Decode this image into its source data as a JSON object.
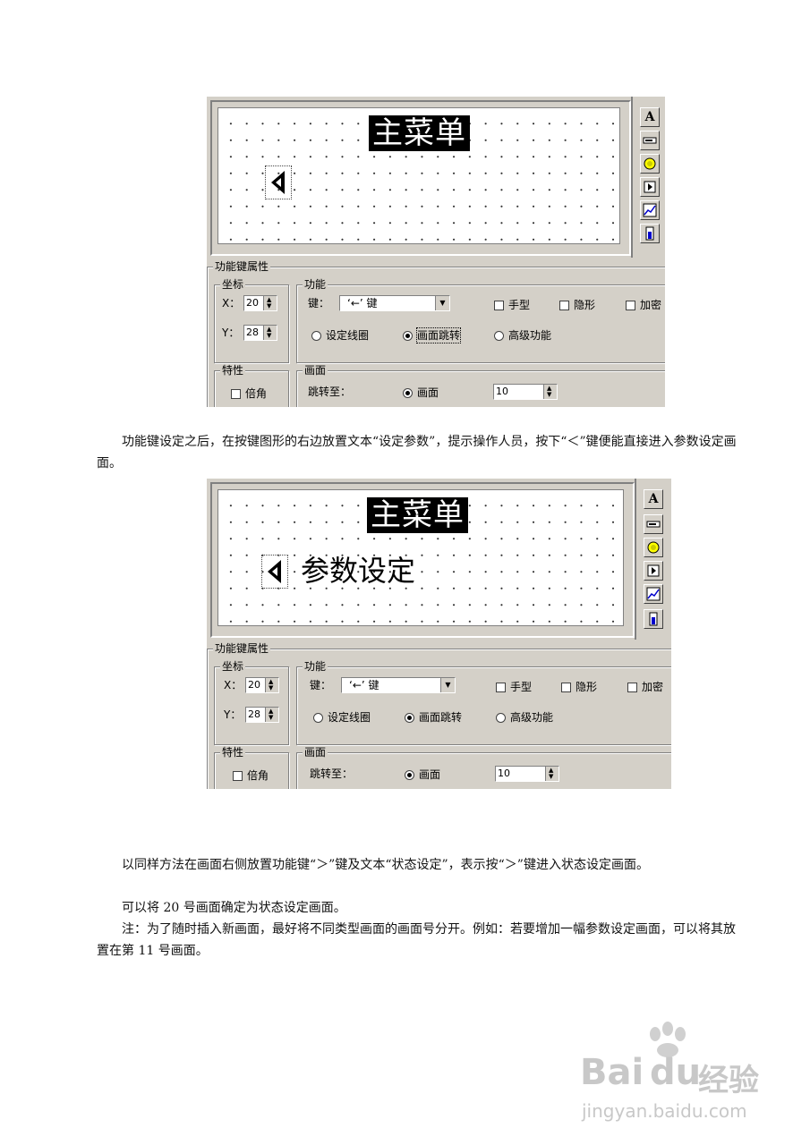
{
  "screens": [
    {
      "canvas": {
        "title": "主菜单",
        "key_text": ""
      },
      "panel": {
        "group_title": "功能键属性",
        "coords": {
          "legend": "坐标",
          "x_label": "X：",
          "x_value": "20",
          "y_label": "Y：",
          "y_value": "28"
        },
        "function": {
          "legend": "功能",
          "key_label": "键：",
          "key_value": "‘←’ 键",
          "checkboxes": [
            "手型",
            "隐形",
            "加密"
          ],
          "radios": [
            "设定线圈",
            "画面跳转",
            "高级功能"
          ],
          "selected_radio": "画面跳转"
        },
        "features": {
          "legend": "特性",
          "checkbox": "倍角"
        },
        "screen": {
          "legend": "画面",
          "jump_label": "跳转至：",
          "radio": "画面",
          "value": "10"
        }
      }
    },
    {
      "canvas": {
        "title": "主菜单",
        "key_text": "参数设定"
      },
      "panel": {
        "group_title": "功能键属性",
        "coords": {
          "legend": "坐标",
          "x_label": "X：",
          "x_value": "20",
          "y_label": "Y：",
          "y_value": "28"
        },
        "function": {
          "legend": "功能",
          "key_label": "键：",
          "key_value": "‘←’ 键",
          "checkboxes": [
            "手型",
            "隐形",
            "加密"
          ],
          "radios": [
            "设定线圈",
            "画面跳转",
            "高级功能"
          ],
          "selected_radio": "画面跳转"
        },
        "features": {
          "legend": "特性",
          "checkbox": "倍角"
        },
        "screen": {
          "legend": "画面",
          "jump_label": "跳转至：",
          "radio": "画面",
          "value": "10"
        }
      }
    }
  ],
  "paragraphs": {
    "p1": "功能键设定之后，在按键图形的右边放置文本“设定参数”，提示操作人员，按下“＜”键便能直接进入参数设定画面。",
    "p2": "以同样方法在画面右侧放置功能键“＞”键及文本“状态设定”，表示按“＞”键进入状态设定画面。",
    "p3": "可以将 20 号画面确定为状态设定画面。",
    "p4": "注：为了随时插入新画面，最好将不同类型画面的画面号分开。例如：若要增加一幅参数设定画面，可以将其放置在第 11 号画面。"
  },
  "watermark": {
    "brand": "Bai",
    "brand2": "du",
    "product": "经验",
    "url": "jingyan.baidu.com"
  },
  "colors": {
    "dialog_bg": "#d4d0c8",
    "canvas_bg": "#ffffff",
    "watermark": "#c8c8c8"
  }
}
